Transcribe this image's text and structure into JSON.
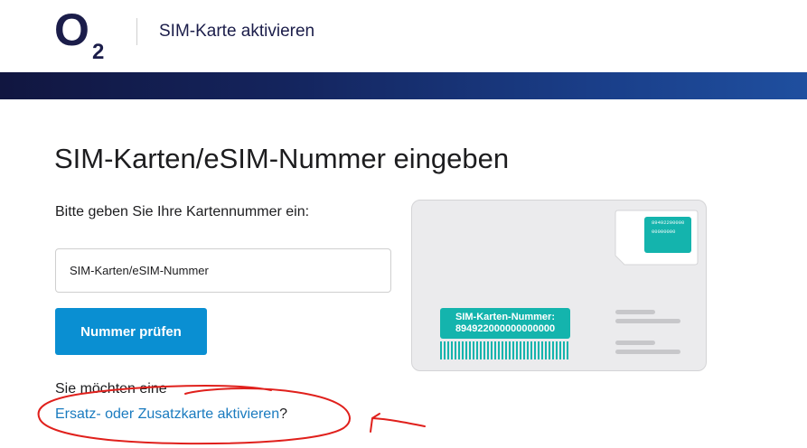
{
  "header": {
    "logo_letter": "O",
    "logo_subscript": "2",
    "title": "SIM-Karte aktivieren"
  },
  "main": {
    "title": "SIM-Karten/eSIM-Nummer eingeben",
    "instruction": "Bitte geben Sie Ihre Kartennummer ein:",
    "input_placeholder": "SIM-Karten/eSIM-Nummer",
    "check_button_label": "Nummer prüfen",
    "alt_text": "Sie möchten eine",
    "alt_link_label": "Ersatz- oder Zusatzkarte aktivieren",
    "alt_link_suffix": "?"
  },
  "sim_illustration": {
    "chip_line1": "89492200000",
    "chip_line2": "00000000",
    "label_line1": "SIM-Karten-Nummer:",
    "label_line2": "894922000000000000"
  },
  "colors": {
    "brand_navy": "#1b1d4a",
    "button_blue": "#0a8fd2",
    "link_blue": "#1a7bbf",
    "sim_teal": "#14b4ad",
    "annotation_red": "#e0201c"
  }
}
